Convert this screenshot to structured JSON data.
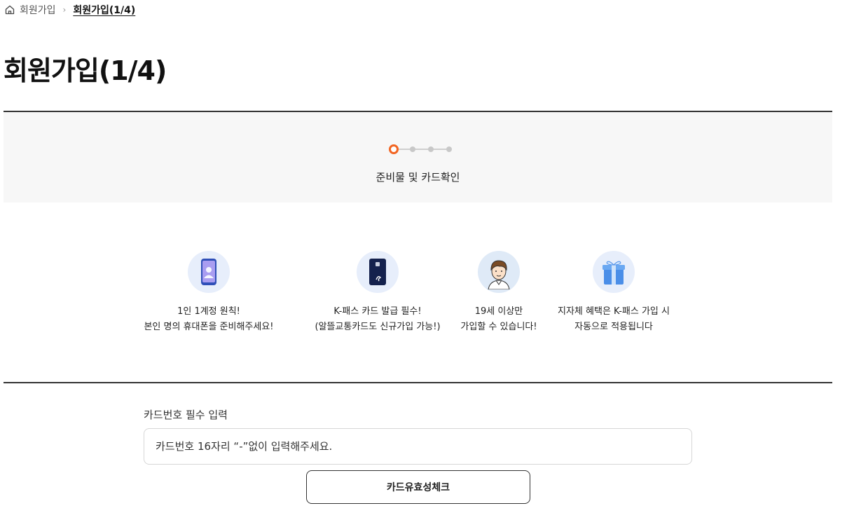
{
  "breadcrumb": {
    "home_icon": "home-icon",
    "items": [
      "회원가입",
      "회원가입(1/4)"
    ]
  },
  "page": {
    "title": "회원가입(1/4)"
  },
  "stepper": {
    "current_step": 1,
    "total_steps": 4,
    "current_label": "준비물 및 카드확인",
    "active_color": "#f26522"
  },
  "features": [
    {
      "icon": "phone-person-icon",
      "line1": "1인 1계정 원칙!",
      "line2": "본인 명의 휴대폰을 준비해주세요!"
    },
    {
      "icon": "kpass-card-icon",
      "line1": "K-패스 카드 발급 필수!",
      "line2": "(알뜰교통카드도 신규가입 가능!)"
    },
    {
      "icon": "adult-person-icon",
      "line1": "19세 이상만",
      "line2": "가입할 수 있습니다!"
    },
    {
      "icon": "gift-box-icon",
      "line1": "지자체 혜택은 K-패스 가입 시",
      "line2": "자동으로 적용됩니다"
    }
  ],
  "card_form": {
    "label": "카드번호 필수 입력",
    "placeholder": "카드번호 16자리 “-”없이 입력해주세요.",
    "check_button": "카드유효성체크"
  }
}
